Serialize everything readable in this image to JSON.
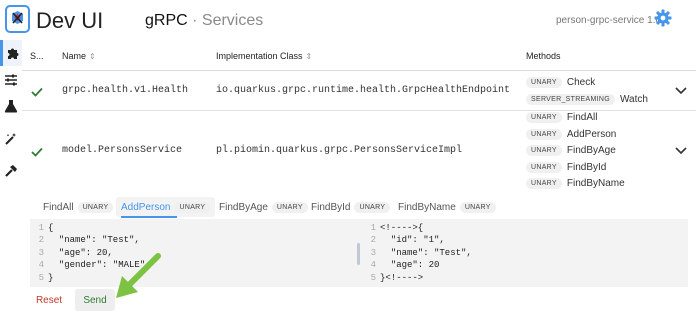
{
  "header": {
    "app_title": "Dev UI",
    "page_title": "gRPC",
    "separator": " · ",
    "page_subtitle": "Services",
    "app_id": "person-grpc-service 1.0",
    "accent": "#4695eb"
  },
  "nav": {
    "items": [
      "puzzle-icon",
      "sliders-icon",
      "flask-icon",
      "magic-wand-icon",
      "hammer-icon"
    ],
    "active_index": 0
  },
  "table": {
    "headers": [
      "S...",
      "Name",
      "Implementation Class",
      "Methods"
    ],
    "rows": [
      {
        "status": "ok",
        "name": "grpc.health.v1.Health",
        "impl": "io.quarkus.grpc.runtime.health.GrpcHealthEndpoint",
        "methods": [
          {
            "type": "UNARY",
            "name": "Check"
          },
          {
            "type": "SERVER_STREAMING",
            "name": "Watch"
          }
        ]
      },
      {
        "status": "ok",
        "name": "model.PersonsService",
        "impl": "pl.piomin.quarkus.grpc.PersonsServiceImpl",
        "methods": [
          {
            "type": "UNARY",
            "name": "FindAll"
          },
          {
            "type": "UNARY",
            "name": "AddPerson"
          },
          {
            "type": "UNARY",
            "name": "FindByAge"
          },
          {
            "type": "UNARY",
            "name": "FindById"
          },
          {
            "type": "UNARY",
            "name": "FindByName"
          }
        ]
      }
    ]
  },
  "tabs": [
    {
      "label": "FindAll",
      "badge": "UNARY",
      "active": false
    },
    {
      "label": "AddPerson",
      "badge": "UNARY",
      "active": true
    },
    {
      "label": "FindByAge",
      "badge": "UNARY",
      "active": false
    },
    {
      "label": "FindById",
      "badge": "UNARY",
      "active": false
    },
    {
      "label": "FindByName",
      "badge": "UNARY",
      "active": false
    }
  ],
  "request_editor": {
    "lines": [
      "{",
      "  \"name\": \"Test\",",
      "  \"age\": 20,",
      "  \"gender\": \"MALE\"",
      "}"
    ]
  },
  "response_editor": {
    "lines": [
      "<!---->{",
      "  \"id\": \"1\",",
      "  \"name\": \"Test\",",
      "  \"age\": 20",
      "}<!---->"
    ]
  },
  "buttons": {
    "reset": "Reset",
    "send": "Send"
  },
  "colors": {
    "success": "#2e7d32",
    "danger": "#c0392b",
    "annotation_arrow": "#7dc243"
  }
}
